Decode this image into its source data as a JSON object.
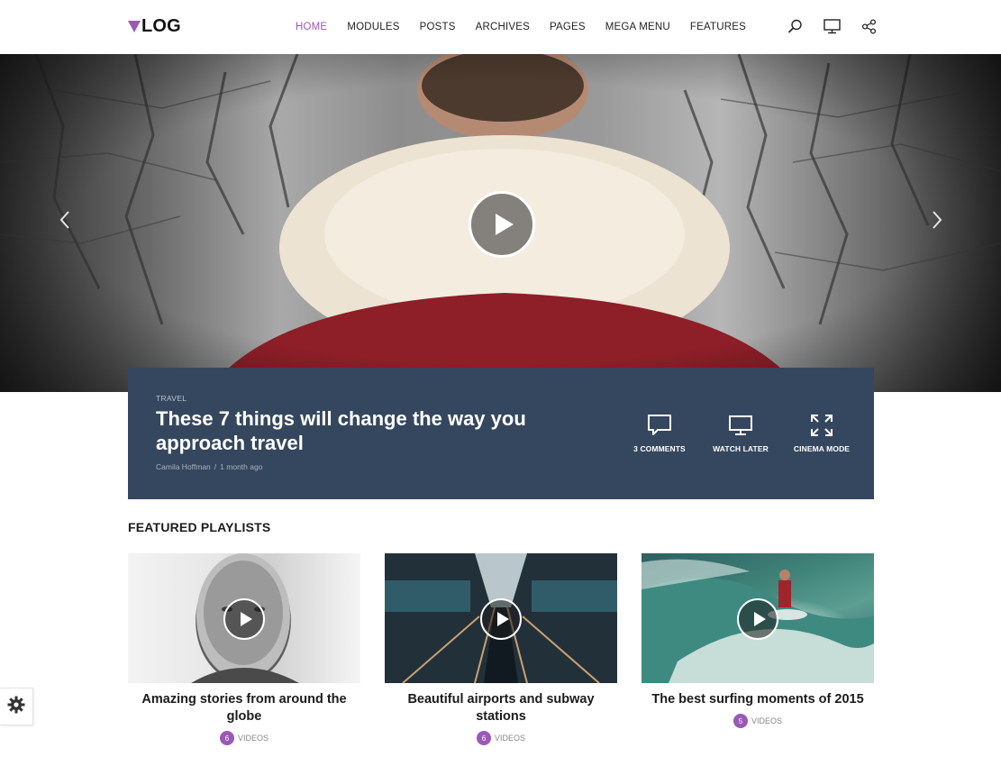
{
  "header": {
    "logo_text": "LOG",
    "nav": [
      {
        "label": "HOME",
        "active": true
      },
      {
        "label": "MODULES",
        "active": false
      },
      {
        "label": "POSTS",
        "active": false
      },
      {
        "label": "ARCHIVES",
        "active": false
      },
      {
        "label": "PAGES",
        "active": false
      },
      {
        "label": "MEGA MENU",
        "active": false
      },
      {
        "label": "FEATURES",
        "active": false
      }
    ],
    "icons": [
      "search-icon",
      "monitor-icon",
      "share-icon"
    ]
  },
  "hero": {
    "category": "TRAVEL",
    "title": "These 7 things will change the way you approach travel",
    "author": "Camila Hoffman",
    "separator": "/",
    "time": "1 month ago",
    "actions": [
      {
        "icon": "comment-icon",
        "label": "3 COMMENTS"
      },
      {
        "icon": "monitor-icon",
        "label": "WATCH LATER"
      },
      {
        "icon": "expand-icon",
        "label": "CINEMA MODE"
      }
    ]
  },
  "featured": {
    "title": "FEATURED PLAYLISTS",
    "playlists": [
      {
        "title": "Amazing stories from around the globe",
        "count": "6",
        "label": "VIDEOS"
      },
      {
        "title": "Beautiful airports and subway stations",
        "count": "6",
        "label": "VIDEOS"
      },
      {
        "title": "The best surfing moments of 2015",
        "count": "5",
        "label": "VIDEOS"
      }
    ]
  },
  "colors": {
    "accent": "#9b59b6",
    "info_box_bg": "#35475e"
  }
}
